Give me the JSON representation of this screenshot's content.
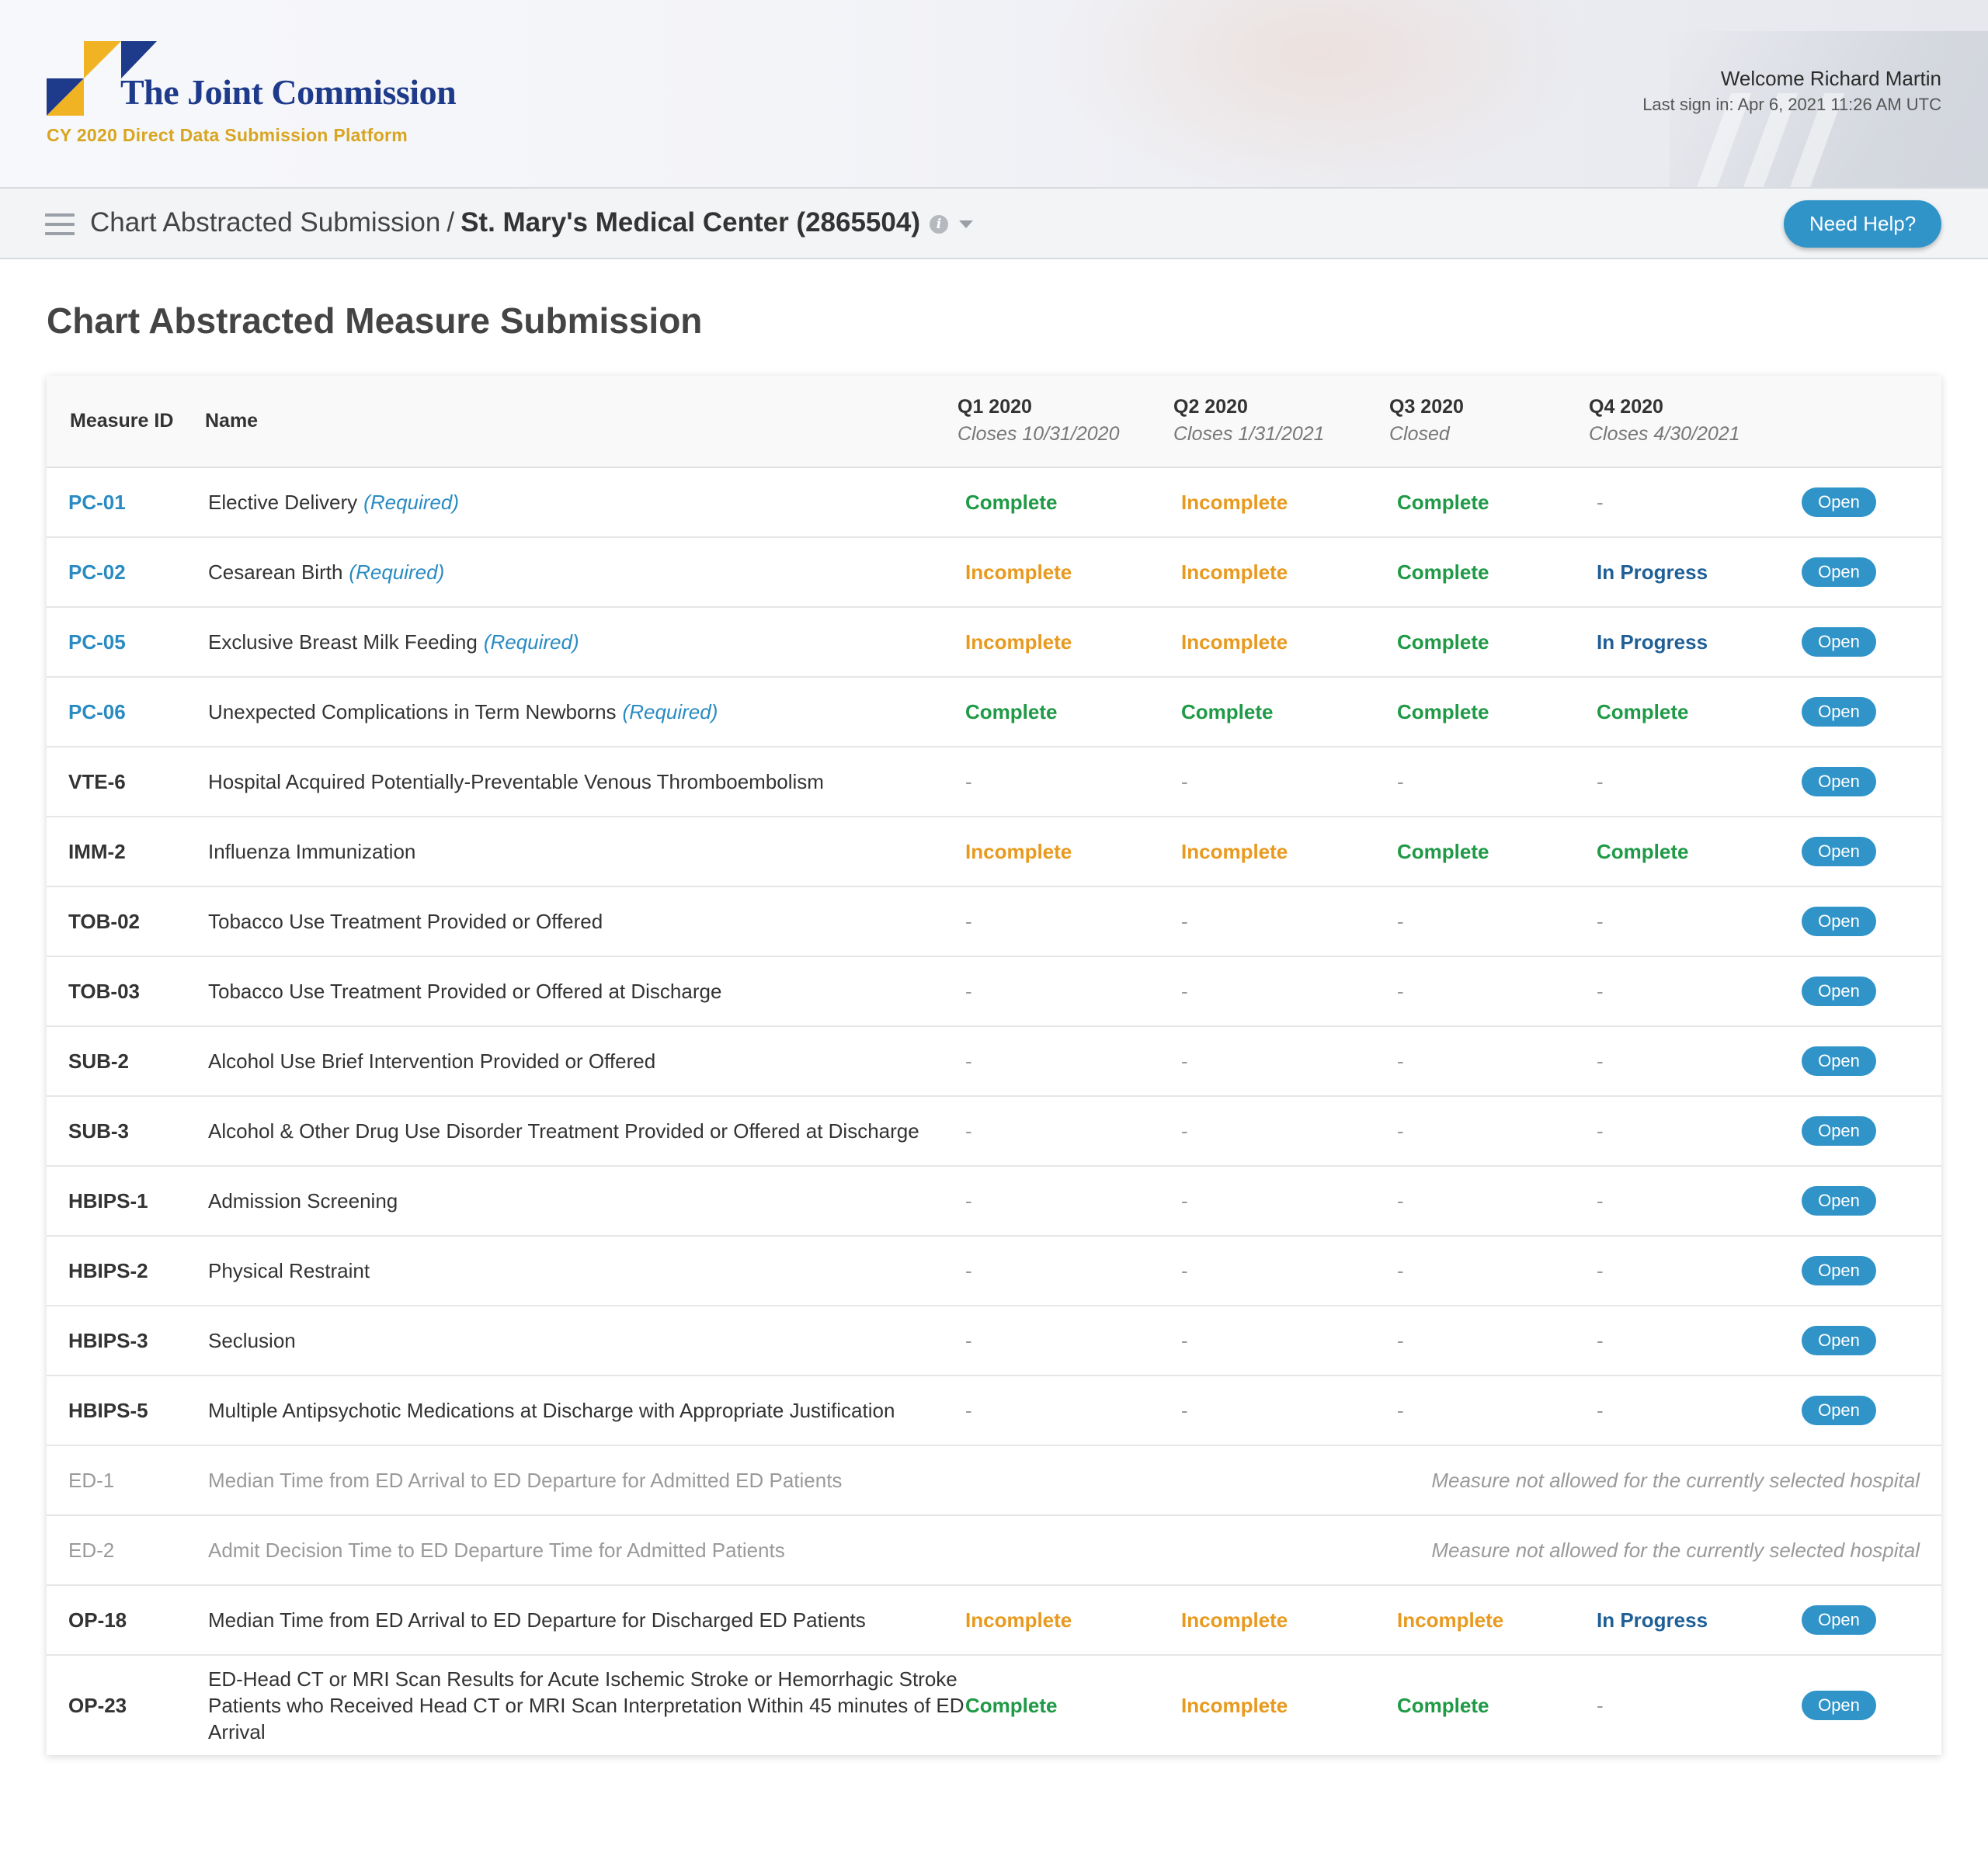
{
  "header": {
    "brand_name": "The Joint Commission",
    "platform": "CY 2020 Direct Data Submission Platform",
    "welcome": "Welcome Richard Martin",
    "last_sign_in": "Last sign in: Apr 6, 2021 11:26 AM UTC",
    "colors": {
      "brand_navy": "#1e3a8a",
      "brand_gold": "#d8a520"
    }
  },
  "nav": {
    "menu_icon": "hamburger-menu-icon",
    "breadcrumb_root": "Chart Abstracted Submission",
    "breadcrumb_separator": "/",
    "facility": "St. Mary's Medical Center (2865504)",
    "info_icon": "info-icon",
    "dropdown_icon": "chevron-down-icon",
    "help_label": "Need Help?"
  },
  "page": {
    "title": "Chart Abstracted Measure Submission"
  },
  "table": {
    "headers": {
      "measure_id": "Measure ID",
      "name": "Name",
      "q1": {
        "label": "Q1 2020",
        "sub": "Closes 10/31/2020"
      },
      "q2": {
        "label": "Q2 2020",
        "sub": "Closes 1/31/2021"
      },
      "q3": {
        "label": "Q3 2020",
        "sub": "Closed"
      },
      "q4": {
        "label": "Q4 2020",
        "sub": "Closes 4/30/2021"
      }
    },
    "action_label": "Open",
    "required_label": "(Required)",
    "rows": [
      {
        "id": "PC-01",
        "name": "Elective Delivery",
        "required": true,
        "q1": "Complete",
        "q2": "Incomplete",
        "q3": "Complete",
        "q4": "-"
      },
      {
        "id": "PC-02",
        "name": "Cesarean Birth",
        "required": true,
        "q1": "Incomplete",
        "q2": "Incomplete",
        "q3": "Complete",
        "q4": "In Progress"
      },
      {
        "id": "PC-05",
        "name": "Exclusive Breast Milk Feeding",
        "required": true,
        "q1": "Incomplete",
        "q2": "Incomplete",
        "q3": "Complete",
        "q4": "In Progress"
      },
      {
        "id": "PC-06",
        "name": "Unexpected Complications in Term Newborns",
        "required": true,
        "q1": "Complete",
        "q2": "Complete",
        "q3": "Complete",
        "q4": "Complete"
      },
      {
        "id": "VTE-6",
        "name": "Hospital Acquired Potentially-Preventable Venous Thromboembolism",
        "q1": "-",
        "q2": "-",
        "q3": "-",
        "q4": "-"
      },
      {
        "id": "IMM-2",
        "name": "Influenza Immunization",
        "q1": "Incomplete",
        "q2": "Incomplete",
        "q3": "Complete",
        "q4": "Complete"
      },
      {
        "id": "TOB-02",
        "name": "Tobacco Use Treatment Provided or Offered",
        "q1": "-",
        "q2": "-",
        "q3": "-",
        "q4": "-"
      },
      {
        "id": "TOB-03",
        "name": "Tobacco Use Treatment Provided or Offered at Discharge",
        "q1": "-",
        "q2": "-",
        "q3": "-",
        "q4": "-"
      },
      {
        "id": "SUB-2",
        "name": "Alcohol Use Brief Intervention Provided or Offered",
        "q1": "-",
        "q2": "-",
        "q3": "-",
        "q4": "-"
      },
      {
        "id": "SUB-3",
        "name": "Alcohol & Other Drug Use Disorder Treatment Provided or Offered at Discharge",
        "q1": "-",
        "q2": "-",
        "q3": "-",
        "q4": "-"
      },
      {
        "id": "HBIPS-1",
        "name": "Admission Screening",
        "q1": "-",
        "q2": "-",
        "q3": "-",
        "q4": "-"
      },
      {
        "id": "HBIPS-2",
        "name": "Physical Restraint",
        "q1": "-",
        "q2": "-",
        "q3": "-",
        "q4": "-"
      },
      {
        "id": "HBIPS-3",
        "name": "Seclusion",
        "q1": "-",
        "q2": "-",
        "q3": "-",
        "q4": "-"
      },
      {
        "id": "HBIPS-5",
        "name": "Multiple Antipsychotic Medications at Discharge with Appropriate Justification",
        "q1": "-",
        "q2": "-",
        "q3": "-",
        "q4": "-"
      },
      {
        "id": "ED-1",
        "name": "Median Time from ED Arrival to ED Departure for Admitted ED Patients",
        "disabled": true,
        "note": "Measure not allowed for the currently selected hospital"
      },
      {
        "id": "ED-2",
        "name": "Admit Decision Time to ED Departure Time for Admitted  Patients",
        "disabled": true,
        "note": "Measure not allowed for the currently selected hospital"
      },
      {
        "id": "OP-18",
        "name": "Median Time from ED Arrival to ED Departure for Discharged ED Patients",
        "q1": "Incomplete",
        "q2": "Incomplete",
        "q3": "Incomplete",
        "q4": "In Progress"
      },
      {
        "id": "OP-23",
        "name": "ED-Head CT or MRI Scan Results for Acute Ischemic Stroke or Hemorrhagic Stroke Patients who Received Head CT or MRI Scan Interpretation Within 45 minutes of ED Arrival",
        "tall": true,
        "q1": "Complete",
        "q2": "Incomplete",
        "q3": "Complete",
        "q4": "-"
      }
    ],
    "status_colors": {
      "Complete": "#1f9a46",
      "Incomplete": "#e79a1f",
      "In Progress": "#1f5f96",
      "-": "#999999"
    }
  }
}
